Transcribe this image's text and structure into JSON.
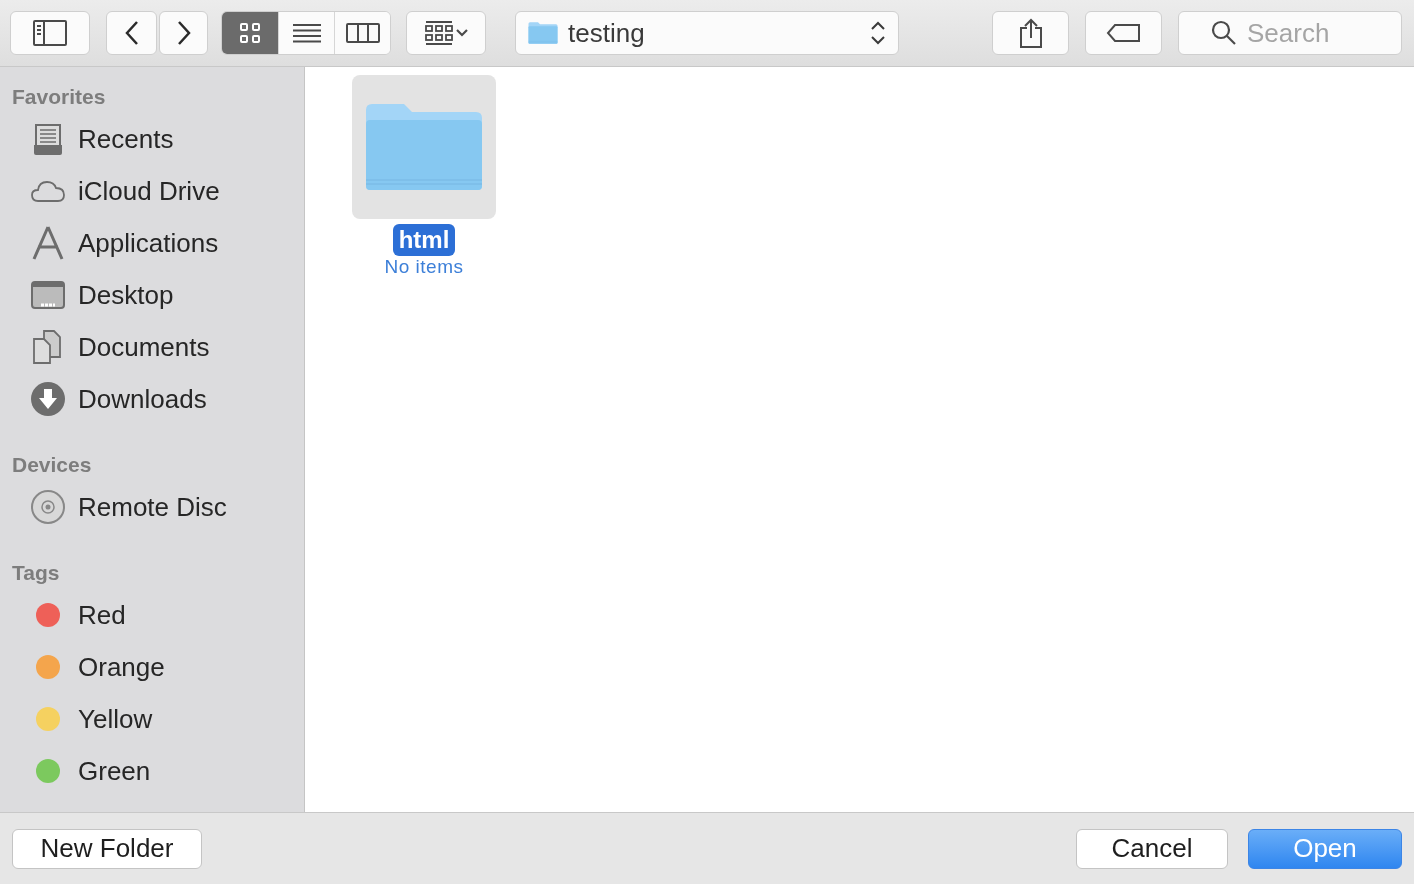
{
  "toolbar": {
    "view_modes": [
      {
        "kind": "icons",
        "selected": true
      },
      {
        "kind": "list",
        "selected": false
      },
      {
        "kind": "columns",
        "selected": false
      }
    ],
    "location": "testing",
    "search": {
      "placeholder": "Search"
    }
  },
  "sidebar": {
    "sections": [
      {
        "title": "Favorites",
        "items": [
          {
            "kind": "recents",
            "label": "Recents"
          },
          {
            "kind": "cloud",
            "label": "iCloud Drive"
          },
          {
            "kind": "applications",
            "label": "Applications"
          },
          {
            "kind": "desktop",
            "label": "Desktop"
          },
          {
            "kind": "documents",
            "label": "Documents"
          },
          {
            "kind": "downloads",
            "label": "Downloads"
          }
        ]
      },
      {
        "title": "Devices",
        "items": [
          {
            "kind": "disc",
            "label": "Remote Disc"
          }
        ]
      },
      {
        "title": "Tags",
        "items": [
          {
            "kind": "tag",
            "label": "Red",
            "color": "#ee6058"
          },
          {
            "kind": "tag",
            "label": "Orange",
            "color": "#f4a54c"
          },
          {
            "kind": "tag",
            "label": "Yellow",
            "color": "#f5d160"
          },
          {
            "kind": "tag",
            "label": "Green",
            "color": "#7cc95e"
          }
        ]
      }
    ]
  },
  "files": [
    {
      "name": "html",
      "info": "No items",
      "selected": true
    }
  ],
  "buttons": [
    {
      "kind": "secondary",
      "label": "New Folder"
    },
    {
      "kind": "secondary",
      "label": "Cancel"
    },
    {
      "kind": "primary",
      "label": "Open"
    }
  ]
}
